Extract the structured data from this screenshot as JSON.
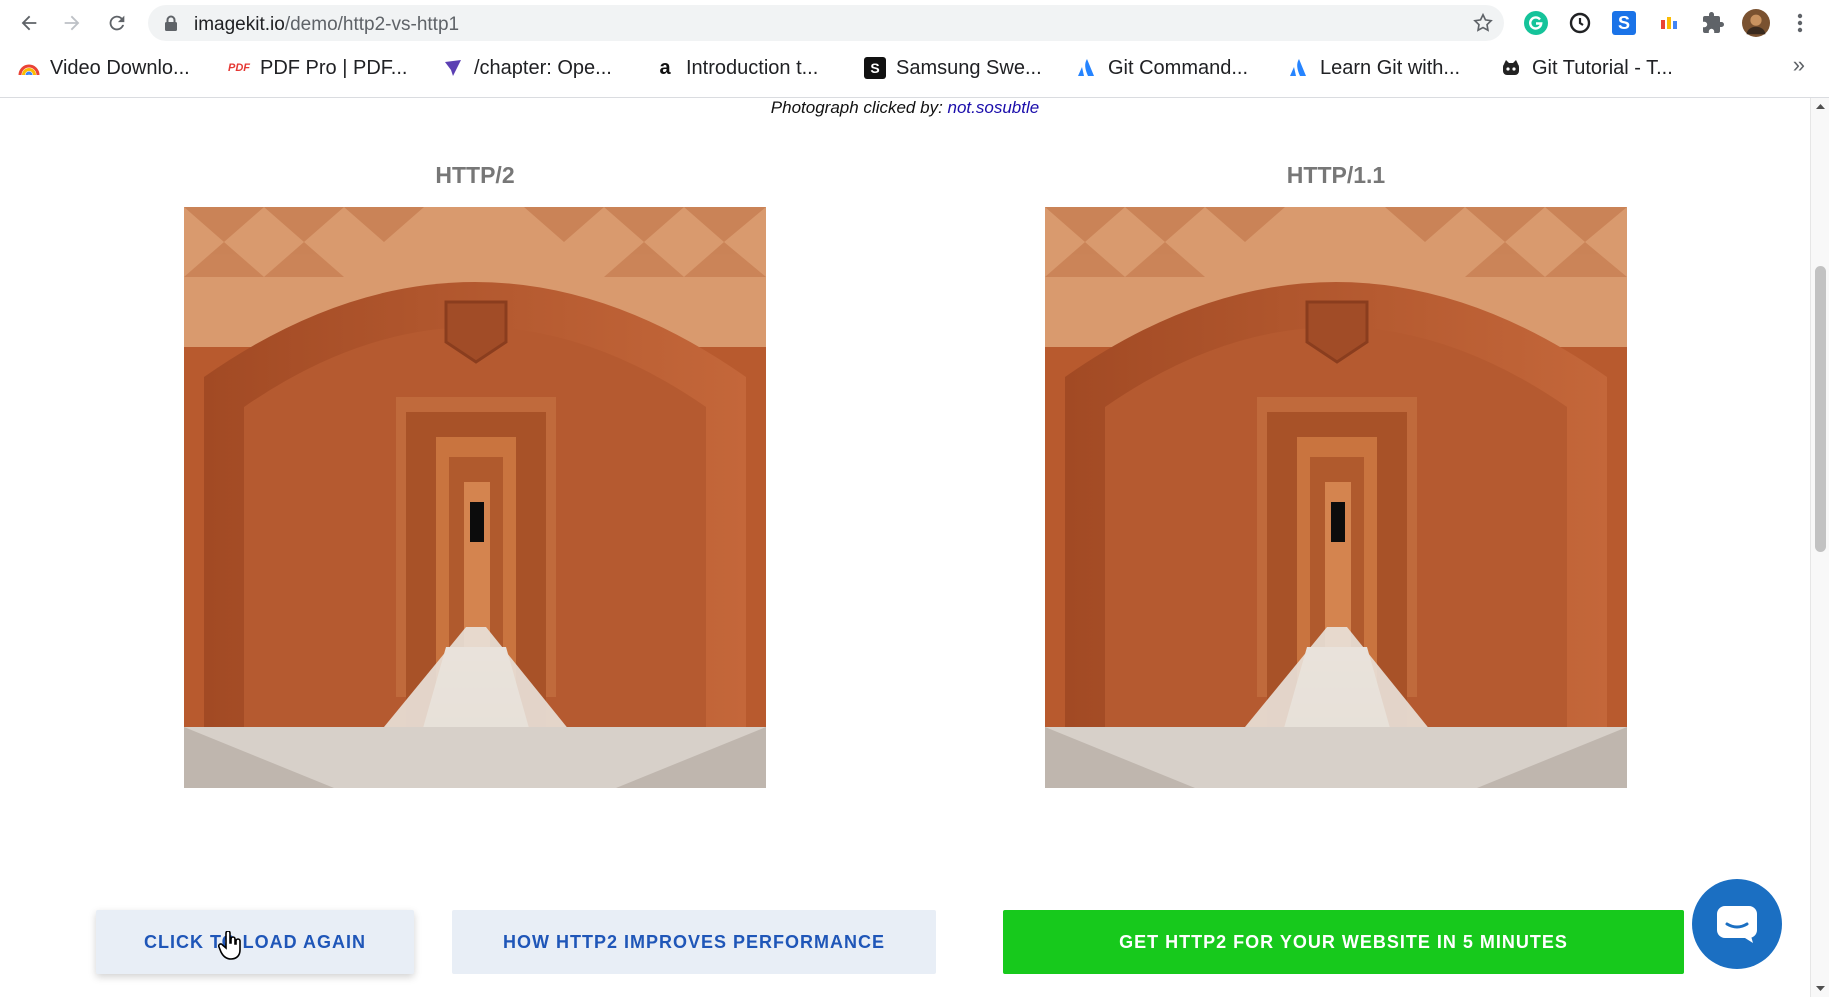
{
  "browser": {
    "url_host": "imagekit.io",
    "url_path": "/demo/http2-vs-http1",
    "bookmarks": [
      {
        "label": "Video Downlo...",
        "icon": "rainbow-icon"
      },
      {
        "label": "PDF Pro | PDF...",
        "icon": "pdf-icon",
        "icon_text": "PDF"
      },
      {
        "label": "/chapter: Ope...",
        "icon": "feather-icon"
      },
      {
        "label": "Introduction t...",
        "icon": "amazon-icon",
        "icon_text": "a"
      },
      {
        "label": "Samsung Swe...",
        "icon": "samsung-icon",
        "icon_text": "S"
      },
      {
        "label": "Git Command...",
        "icon": "atlassian-icon"
      },
      {
        "label": "Learn Git with...",
        "icon": "atlassian-icon"
      },
      {
        "label": "Git Tutorial - T...",
        "icon": "octocat-icon"
      }
    ],
    "overflow_label": "»",
    "ext_s_label": "S"
  },
  "page": {
    "credit_prefix": "Photograph clicked by: ",
    "credit_link": "not.sosubtle",
    "left_title": "HTTP/2",
    "right_title": "HTTP/1.1",
    "buttons": {
      "reload": "CLICK TO LOAD AGAIN",
      "how": "HOW HTTP2 IMPROVES PERFORMANCE",
      "get": "GET HTTP2 FOR YOUR WEBSITE IN 5 MINUTES"
    }
  },
  "colors": {
    "accent_green": "#17c91c",
    "link_blue": "#1f56b8",
    "chat_blue": "#1b6fc2"
  }
}
